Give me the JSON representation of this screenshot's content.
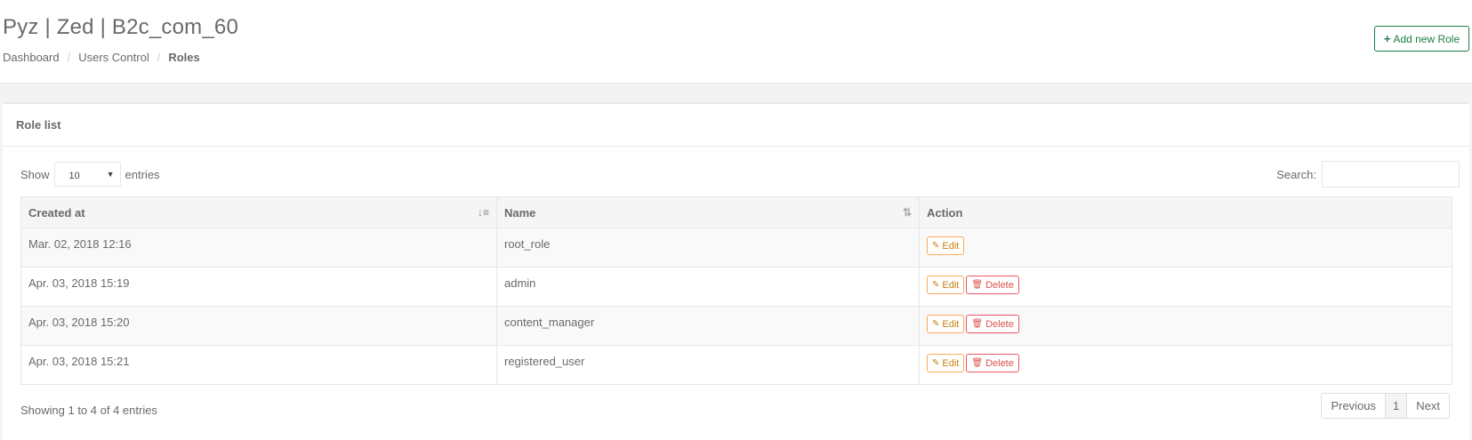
{
  "header": {
    "title": "Pyz | Zed | B2c_com_60",
    "breadcrumb": [
      "Dashboard",
      "Users Control",
      "Roles"
    ],
    "add_button_label": "Add new Role",
    "add_button_icon": "plus-icon"
  },
  "box": {
    "title": "Role list",
    "show_label": "Show",
    "entries_label": "entries",
    "page_length": "10",
    "search_label": "Search:",
    "search_value": ""
  },
  "table": {
    "columns": [
      "Created at",
      "Name",
      "Action"
    ],
    "rows": [
      {
        "created_at": "Mar. 02, 2018 12:16",
        "name": "root_role",
        "actions": [
          "Edit"
        ]
      },
      {
        "created_at": "Apr. 03, 2018 15:19",
        "name": "admin",
        "actions": [
          "Edit",
          "Delete"
        ]
      },
      {
        "created_at": "Apr. 03, 2018 15:20",
        "name": "content_manager",
        "actions": [
          "Edit",
          "Delete"
        ]
      },
      {
        "created_at": "Apr. 03, 2018 15:21",
        "name": "registered_user",
        "actions": [
          "Edit",
          "Delete"
        ]
      }
    ],
    "edit_label": "Edit",
    "delete_label": "Delete"
  },
  "footer": {
    "info": "Showing 1 to 4 of 4 entries",
    "pagination": [
      "Previous",
      "1",
      "Next"
    ]
  },
  "colors": {
    "primary_green": "#1a7d47",
    "edit_orange": "#f8ac59",
    "delete_red": "#ed5565"
  }
}
